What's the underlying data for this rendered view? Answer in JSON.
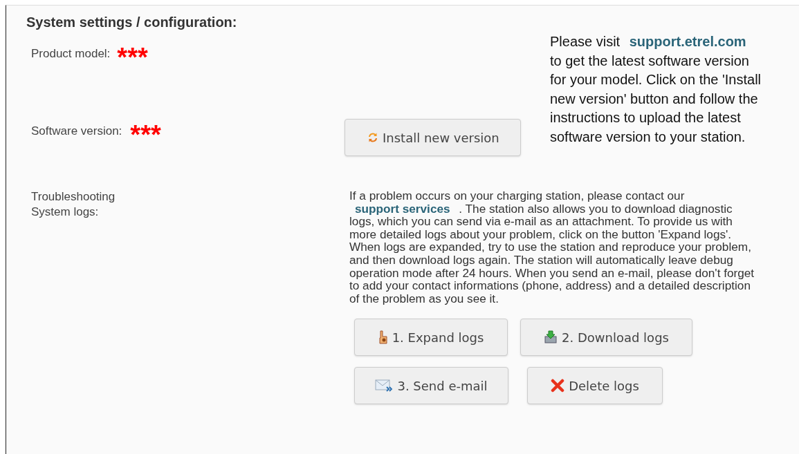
{
  "heading": "System settings / configuration:",
  "product_model": {
    "label": "Product model:",
    "value": "***"
  },
  "software_version": {
    "label": "Software version:",
    "value": "***"
  },
  "install_button": {
    "label": "Install new version"
  },
  "update_help": {
    "before": "Please visit",
    "link": "support.etrel.com",
    "after": "to get the latest software version for your model. Click on the 'Install new version' button and follow the instructions to upload the latest software version to your station."
  },
  "troubleshooting": {
    "label": "Troubleshooting\nSystem logs:",
    "before": "If a problem occurs on your charging station, please contact our",
    "link": "support services",
    "after": ". The station also allows you to download diagnostic logs, which you can send via e-mail as an attachment. To provide us with more detailed logs about your problem, click on the button 'Expand logs'. When logs are expanded, try to use the station and reproduce your problem, and then download logs again. The station will automatically leave debug operation mode after 24 hours. When you send an e-mail, please don't forget to add your contact informations (phone, address) and a detailed description of the problem as you see it."
  },
  "log_buttons": [
    {
      "kind": "expand",
      "label": "1. Expand logs"
    },
    {
      "kind": "download",
      "label": "2. Download logs"
    },
    {
      "kind": "email",
      "label": "3. Send e-mail"
    },
    {
      "kind": "delete",
      "label": "Delete logs"
    }
  ]
}
